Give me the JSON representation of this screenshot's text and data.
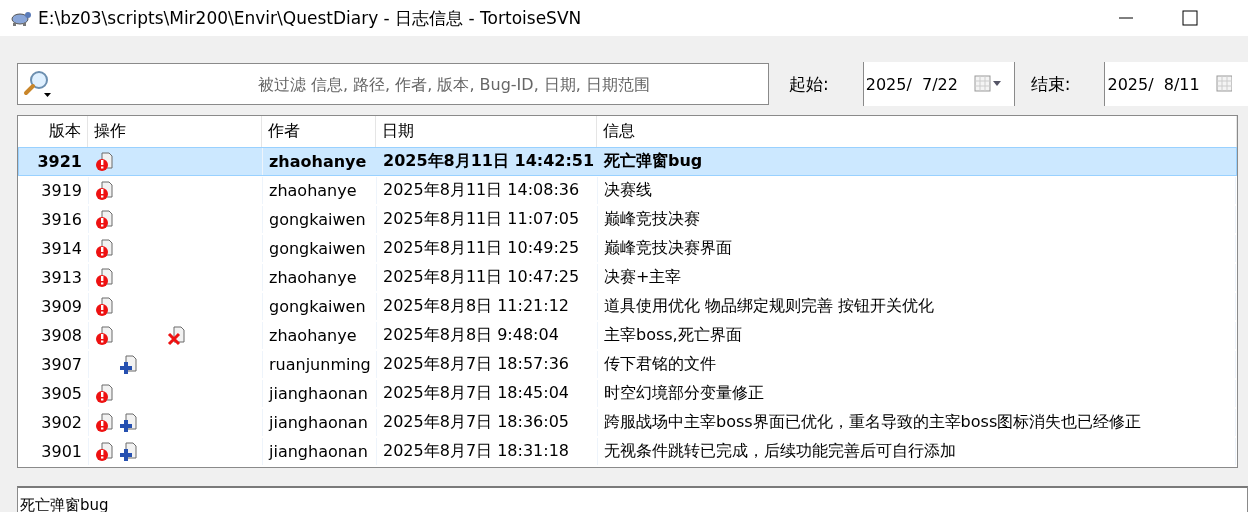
{
  "window": {
    "title": "E:\\bz03\\scripts\\Mir200\\Envir\\QuestDiary - 日志信息 - TortoiseSVN"
  },
  "filter": {
    "placeholder": "被过滤 信息, 路径, 作者, 版本, Bug-ID, 日期, 日期范围"
  },
  "date_from": {
    "label": "起始:",
    "value": "2025/  7/22"
  },
  "date_to": {
    "label": "结束:",
    "value": "2025/  8/11"
  },
  "table": {
    "columns": [
      "版本",
      "操作",
      "作者",
      "日期",
      "信息"
    ],
    "rows": [
      {
        "revision": "3921",
        "modified": true,
        "added": false,
        "deleted": false,
        "author": "zhaohanye",
        "date": "2025年8月11日 14:42:51",
        "message": "死亡弹窗bug",
        "selected": true
      },
      {
        "revision": "3919",
        "modified": true,
        "added": false,
        "deleted": false,
        "author": "zhaohanye",
        "date": "2025年8月11日 14:08:36",
        "message": "决赛线",
        "selected": false
      },
      {
        "revision": "3916",
        "modified": true,
        "added": false,
        "deleted": false,
        "author": "gongkaiwen",
        "date": "2025年8月11日 11:07:05",
        "message": "巅峰竞技决赛",
        "selected": false
      },
      {
        "revision": "3914",
        "modified": true,
        "added": false,
        "deleted": false,
        "author": "gongkaiwen",
        "date": "2025年8月11日 10:49:25",
        "message": "巅峰竞技决赛界面",
        "selected": false
      },
      {
        "revision": "3913",
        "modified": true,
        "added": false,
        "deleted": false,
        "author": "zhaohanye",
        "date": "2025年8月11日 10:47:25",
        "message": "决赛+主宰",
        "selected": false
      },
      {
        "revision": "3909",
        "modified": true,
        "added": false,
        "deleted": false,
        "author": "gongkaiwen",
        "date": "2025年8月8日 11:21:12",
        "message": "道具使用优化 物品绑定规则完善 按钮开关优化",
        "selected": false
      },
      {
        "revision": "3908",
        "modified": true,
        "added": false,
        "deleted": true,
        "author": "zhaohanye",
        "date": "2025年8月8日 9:48:04",
        "message": "主宰boss,死亡界面",
        "selected": false
      },
      {
        "revision": "3907",
        "modified": false,
        "added": true,
        "deleted": false,
        "author": "ruanjunming",
        "date": "2025年8月7日 18:57:36",
        "message": "传下君铭的文件",
        "selected": false
      },
      {
        "revision": "3905",
        "modified": true,
        "added": false,
        "deleted": false,
        "author": "jianghaonan",
        "date": "2025年8月7日 18:45:04",
        "message": "时空幻境部分变量修正",
        "selected": false
      },
      {
        "revision": "3902",
        "modified": true,
        "added": true,
        "deleted": false,
        "author": "jianghaonan",
        "date": "2025年8月7日 18:36:05",
        "message": "跨服战场中主宰boss界面已优化，重名导致的主宰boss图标消失也已经修正",
        "selected": false
      },
      {
        "revision": "3901",
        "modified": true,
        "added": true,
        "deleted": false,
        "author": "jianghaonan",
        "date": "2025年8月7日 18:31:18",
        "message": "无视条件跳转已完成，后续功能完善后可自行添加",
        "selected": false
      }
    ]
  },
  "message_box": {
    "value": "死亡弹窗bug"
  }
}
